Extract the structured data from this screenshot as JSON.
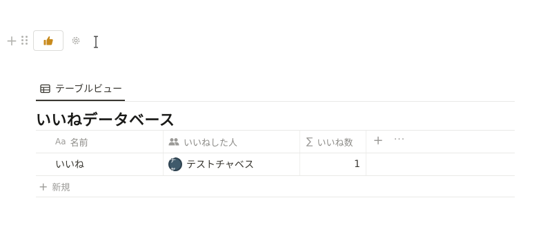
{
  "block_controls": {
    "plus_icon": "plus-icon",
    "drag_icon": "drag-handle-icon",
    "like_button_icon": "thumbs-up-icon",
    "settings_icon": "gear-icon"
  },
  "view_tab": {
    "icon": "table-icon",
    "label": "テーブルビュー"
  },
  "database": {
    "title": "いいねデータベース"
  },
  "table": {
    "columns": [
      {
        "icon": "text-type-icon",
        "icon_text": "Aa",
        "label": "名前"
      },
      {
        "icon": "people-icon",
        "label": "いいねした人"
      },
      {
        "icon": "sigma-icon",
        "icon_text": "∑",
        "label": "いいね数"
      }
    ],
    "add_column_icon": "plus-icon",
    "more_icon": "more-icon",
    "rows": [
      {
        "name": "いいね",
        "person_avatar_text": "チャ",
        "person": "テストチャベス",
        "count": "1"
      }
    ],
    "new_row": {
      "icon_text": "+",
      "label": "新規"
    }
  },
  "colors": {
    "text": "#37352f",
    "muted": "#9b9a97",
    "divider": "#e9e9e7",
    "like_icon": "#c88a1c",
    "avatar": "#3f5a6b"
  }
}
